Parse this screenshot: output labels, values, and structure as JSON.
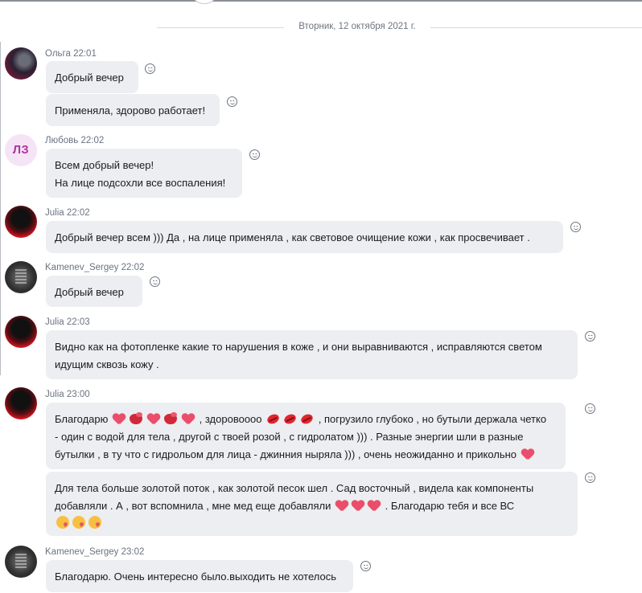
{
  "date_separator": "Вторник, 12 октября 2021 г.",
  "avatars": {
    "lz_initials": "ЛЗ"
  },
  "messages": [
    {
      "sender": "Ольга",
      "time": "22:01",
      "lines": [
        "Добрый вечер"
      ]
    },
    {
      "lines": [
        "Применяла, здорово работает!"
      ]
    },
    {
      "sender": "Любовь",
      "time": "22:02",
      "lines": [
        "Всем добрый вечер!",
        "На лице подсохли все воспаления!"
      ]
    },
    {
      "sender": "Julia",
      "time": "22:02",
      "lines": [
        "Добрый вечер всем )))  Да , на лице применяла , как световое очищение кожи , как просвечивает ."
      ]
    },
    {
      "sender": "Kamenev_Sergey",
      "time": "22:02",
      "lines": [
        "Добрый вечер"
      ]
    },
    {
      "sender": "Julia",
      "time": "22:03",
      "lines": [
        "Видно как на фотопленке какие то нарушения в коже , и они выравниваются , исправляются светом",
        "идущим сквозь кожу ."
      ]
    },
    {
      "sender": "Julia",
      "time": "23:00",
      "text": {
        "a": "Благодарю",
        "b": ", здоровоооо",
        "c": ", погрузило глубоко , но бутыли держала четко",
        "line2": "- один с водой для тела , другой с твоей розой , с гидролатом ))) . Разные энергии шли в разные",
        "line3": "бутылки , в ту что с гидрольом для лица - джинния ныряла ))) , очень неожиданно и прикольно"
      }
    },
    {
      "text": {
        "line1": "Для тела больше золотой поток , как золотой песок шел . Сад восточный , видела как компоненты",
        "line2a": "добавляли . А , вот вспомнила , мне мед еще добавляли",
        "line2b": ". Благодарю тебя и все ВС"
      }
    },
    {
      "sender": "Kamenev_Sergey",
      "time": "23:02",
      "lines": [
        "Благодарю. Очень интересно было.выходить не хотелось"
      ]
    }
  ],
  "icons": {
    "reaction": "add-reaction-smiley-icon",
    "heart": "red-heart-emoji",
    "kiss_face": "face-blowing-kiss-emoji",
    "lips": "kiss-mark-emoji",
    "wink": "winking-kiss-face-emoji"
  },
  "colors": {
    "bubble": "#eceef1",
    "meta_text": "#6a7380",
    "heart": "#ea4e6b",
    "lz_avatar_text": "#b2329e"
  }
}
